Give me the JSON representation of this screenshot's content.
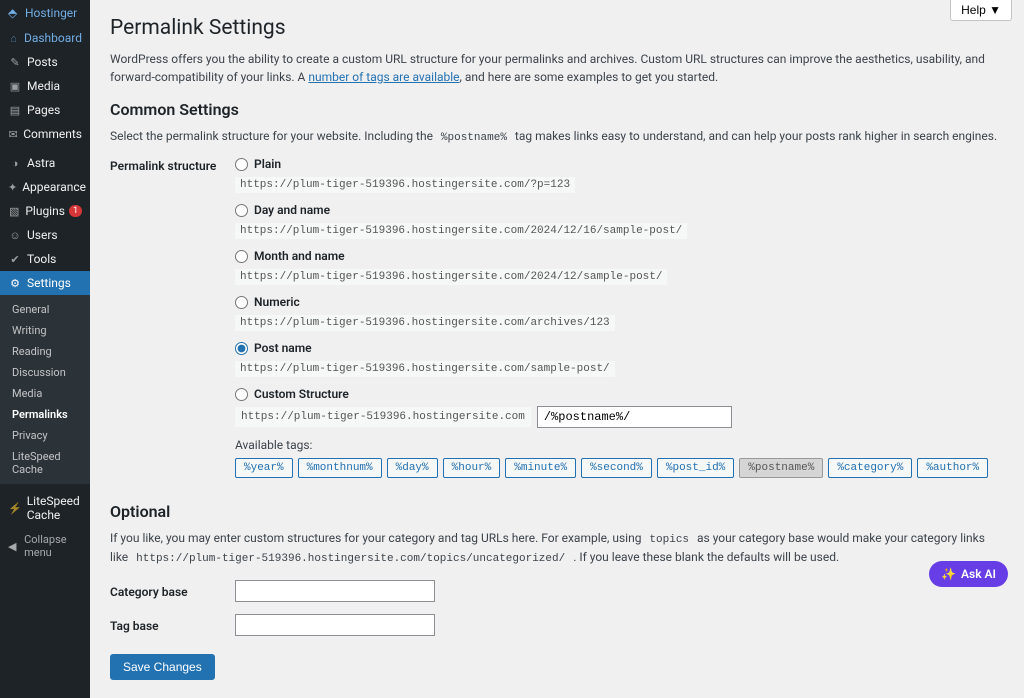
{
  "brand": {
    "name": "Hostinger"
  },
  "sidebar": {
    "items": [
      {
        "icon": "⌂",
        "label": "Dashboard",
        "hl": true
      },
      {
        "icon": "✎",
        "label": "Posts"
      },
      {
        "icon": "▣",
        "label": "Media"
      },
      {
        "icon": "▤",
        "label": "Pages"
      },
      {
        "icon": "✉",
        "label": "Comments"
      },
      {
        "sep": true
      },
      {
        "icon": "◑",
        "label": "Astra"
      },
      {
        "icon": "✦",
        "label": "Appearance"
      },
      {
        "icon": "▧",
        "label": "Plugins",
        "badge": "1"
      },
      {
        "icon": "☺",
        "label": "Users"
      },
      {
        "icon": "✔",
        "label": "Tools"
      },
      {
        "icon": "⚙",
        "label": "Settings",
        "cur": true
      },
      {
        "sep": true
      },
      {
        "icon": "⚡",
        "label": "LiteSpeed Cache"
      }
    ],
    "sub": [
      {
        "label": "General"
      },
      {
        "label": "Writing"
      },
      {
        "label": "Reading"
      },
      {
        "label": "Discussion"
      },
      {
        "label": "Media"
      },
      {
        "label": "Permalinks",
        "cur": true
      },
      {
        "label": "Privacy"
      },
      {
        "label": "LiteSpeed Cache"
      }
    ],
    "collapse": "Collapse menu"
  },
  "help": "Help ▼",
  "page": {
    "title": "Permalink Settings",
    "intro1": "WordPress offers you the ability to create a custom URL structure for your permalinks and archives. Custom URL structures can improve the aesthetics, usability, and forward-compatibility of your links. A ",
    "intro_link": "number of tags are available",
    "intro2": ", and here are some examples to get you started.",
    "h2": "Common Settings",
    "desc1": "Select the permalink structure for your website. Including the ",
    "desc_code": "%postname%",
    "desc2": " tag makes links easy to understand, and can help your posts rank higher in search engines.",
    "struct_label": "Permalink structure",
    "options": [
      {
        "label": "Plain",
        "ex": "https://plum-tiger-519396.hostingersite.com/?p=123"
      },
      {
        "label": "Day and name",
        "ex": "https://plum-tiger-519396.hostingersite.com/2024/12/16/sample-post/"
      },
      {
        "label": "Month and name",
        "ex": "https://plum-tiger-519396.hostingersite.com/2024/12/sample-post/"
      },
      {
        "label": "Numeric",
        "ex": "https://plum-tiger-519396.hostingersite.com/archives/123"
      },
      {
        "label": "Post name",
        "ex": "https://plum-tiger-519396.hostingersite.com/sample-post/",
        "checked": true
      },
      {
        "label": "Custom Structure"
      }
    ],
    "custom_base": "https://plum-tiger-519396.hostingersite.com",
    "custom_val": "/%postname%/",
    "avail": "Available tags:",
    "tags": [
      "%year%",
      "%monthnum%",
      "%day%",
      "%hour%",
      "%minute%",
      "%second%",
      "%post_id%",
      "%postname%",
      "%category%",
      "%author%"
    ],
    "active_tag": "%postname%",
    "optional_h": "Optional",
    "opt1": "If you like, you may enter custom structures for your category and tag URLs here. For example, using ",
    "opt_code1": "topics",
    "opt2": " as your category base would make your category links like ",
    "opt_code2": "https://plum-tiger-519396.hostingersite.com/topics/uncategorized/",
    "opt3": " . If you leave these blank the defaults will be used.",
    "cat_label": "Category base",
    "tag_label": "Tag base",
    "save": "Save Changes"
  },
  "askai": "Ask AI"
}
